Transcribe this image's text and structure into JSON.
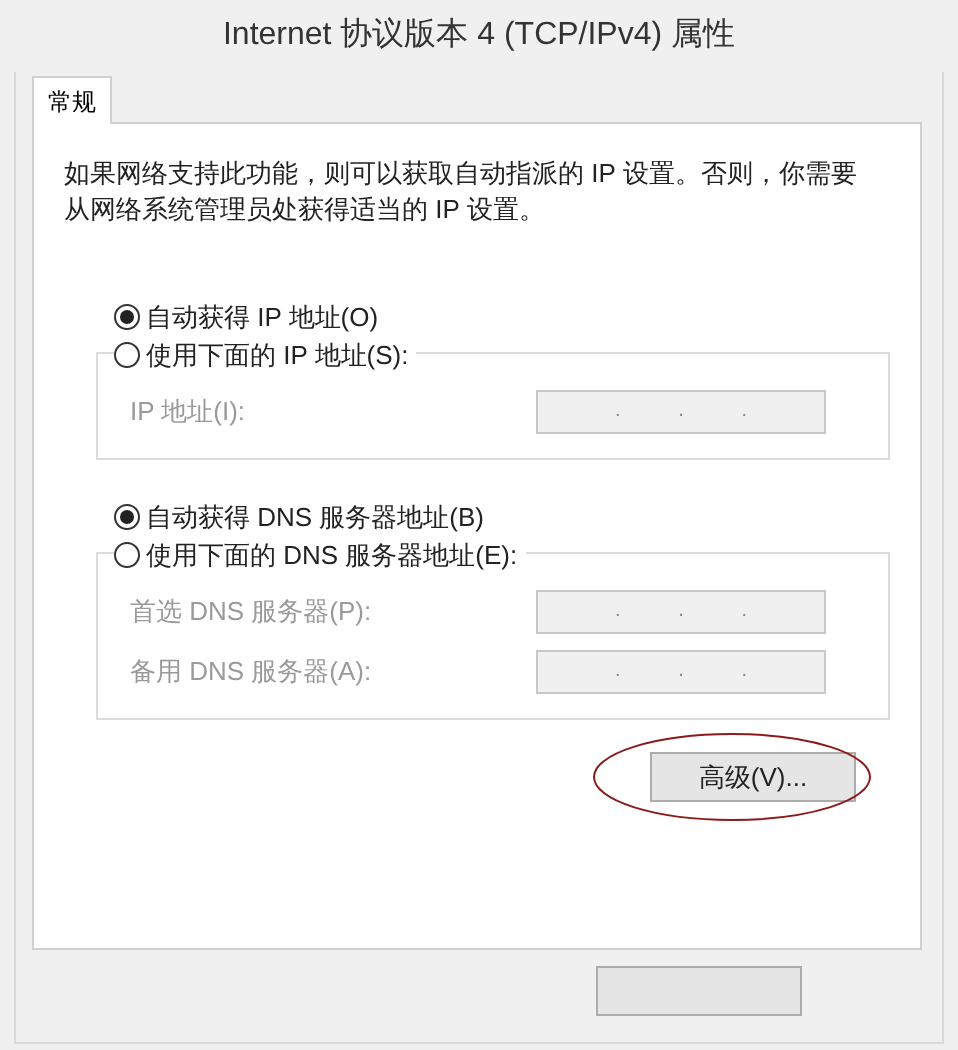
{
  "window": {
    "title": "Internet 协议版本 4 (TCP/IPv4) 属性"
  },
  "tabs": [
    {
      "label": "常规",
      "selected": true
    }
  ],
  "description": "如果网络支持此功能，则可以获取自动指派的 IP 设置。否则，你需要从网络系统管理员处获得适当的 IP 设置。",
  "ip_section": {
    "options": [
      {
        "label": "自动获得 IP 地址(O)",
        "selected": true
      },
      {
        "label": "使用下面的 IP 地址(S):",
        "selected": false
      }
    ],
    "fields": [
      {
        "label": "IP 地址(I):",
        "disabled": true,
        "separators": [
          ".",
          ".",
          "."
        ]
      }
    ]
  },
  "dns_section": {
    "options": [
      {
        "label": "自动获得 DNS 服务器地址(B)",
        "selected": true
      },
      {
        "label": "使用下面的 DNS 服务器地址(E):",
        "selected": false
      }
    ],
    "fields": [
      {
        "label": "首选 DNS 服务器(P):",
        "disabled": true,
        "separators": [
          ".",
          ".",
          "."
        ]
      },
      {
        "label": "备用 DNS 服务器(A):",
        "disabled": true,
        "separators": [
          ".",
          ".",
          "."
        ]
      }
    ]
  },
  "advanced_button": {
    "label": "高级(V)..."
  }
}
